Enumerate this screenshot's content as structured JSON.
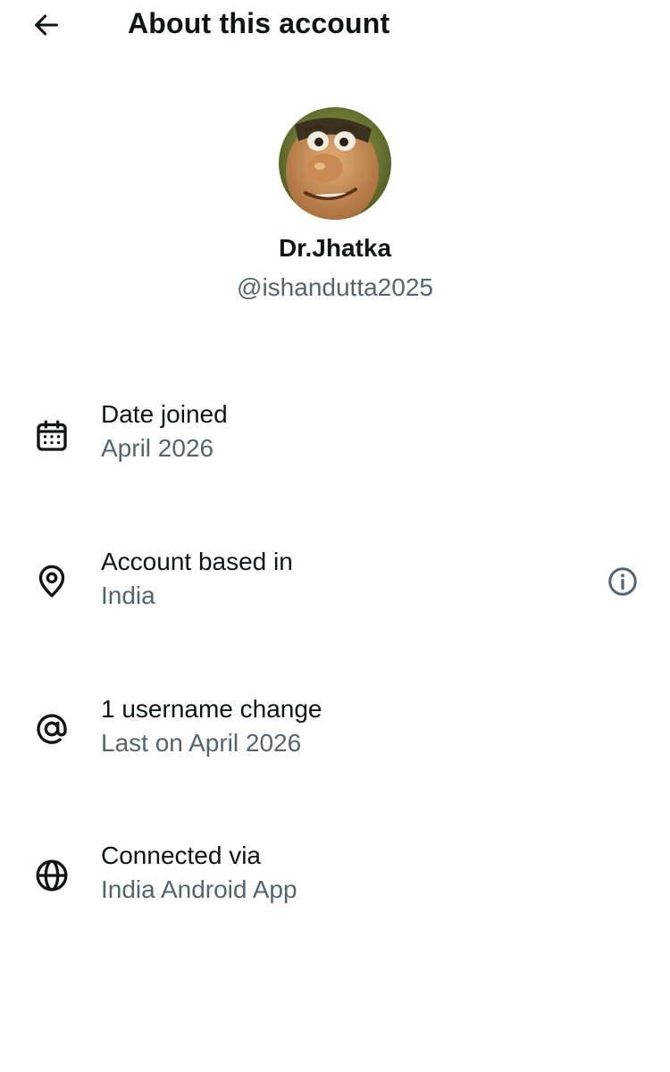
{
  "header": {
    "title": "About this account",
    "back_icon": "arrow-left-icon"
  },
  "profile": {
    "display_name": "Dr.Jhatka",
    "handle": "@ishandutta2025",
    "avatar": "cartoon-face-avatar"
  },
  "details": [
    {
      "icon": "calendar-icon",
      "title": "Date joined",
      "value": "April 2026"
    },
    {
      "icon": "location-pin-icon",
      "title": "Account based in",
      "value": "India",
      "info_icon": "info-icon"
    },
    {
      "icon": "at-sign-icon",
      "title": "1 username change",
      "value": "Last on April 2026"
    },
    {
      "icon": "globe-icon",
      "title": "Connected via",
      "value": "India Android App"
    }
  ],
  "colors": {
    "primary_text": "#0f1419",
    "secondary_text": "#536471",
    "background": "#ffffff"
  }
}
